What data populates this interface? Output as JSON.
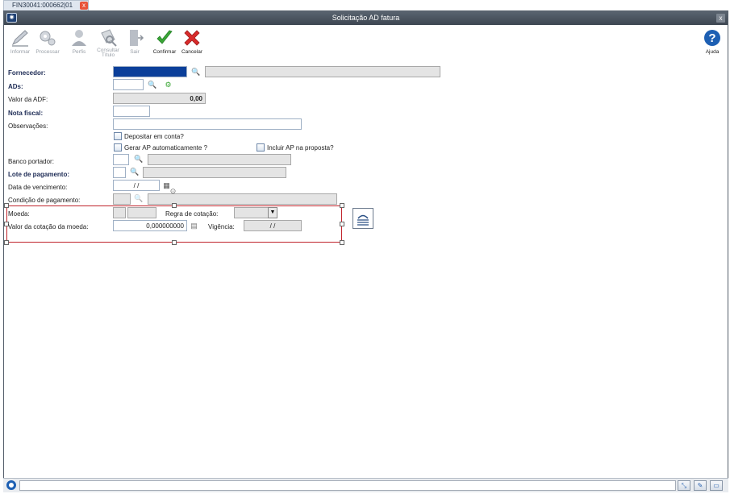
{
  "tab": {
    "label": "FIN30041:000662|01",
    "close": "x"
  },
  "window": {
    "title": "Solicitação AD fatura",
    "close": "x"
  },
  "toolbar": {
    "informar": "Informar",
    "processar": "Processar",
    "perfis": "Perfis",
    "consultar_titulo": "Consultar Título",
    "sair": "Sair",
    "confirmar": "Confirmar",
    "cancelar": "Cancelar",
    "ajuda": "Ajuda"
  },
  "form": {
    "fornecedor_label": "Fornecedor:",
    "ads_label": "ADs:",
    "valor_adf_label": "Valor da ADF:",
    "valor_adf_value": "0,00",
    "nota_fiscal_label": "Nota fiscal:",
    "observacoes_label": "Observações:",
    "depositar_label": "Depositar em conta?",
    "gerar_ap_label": "Gerar AP automaticamente ?",
    "incluir_ap_label": "Incluir AP na proposta?",
    "banco_portador_label": "Banco portador:",
    "lote_pagamento_label": "Lote de pagamento:",
    "data_vencimento_label": "Data de vencimento:",
    "data_vencimento_value": "/ /",
    "condicao_pagamento_label": "Condição de pagamento:",
    "moeda_label": "Moeda:",
    "regra_cotacao_label": "Regra de cotação:",
    "valor_cotacao_label": "Valor da cotação da moeda:",
    "valor_cotacao_value": "0,000000000",
    "vigencia_label": "Vigência:",
    "vigencia_value": "/ /"
  },
  "colors": {
    "required_label": "#1d2b55",
    "selection_border": "#c0232b",
    "confirm": "#3aa635",
    "cancel": "#d92b2b",
    "help": "#1d5fb3"
  }
}
